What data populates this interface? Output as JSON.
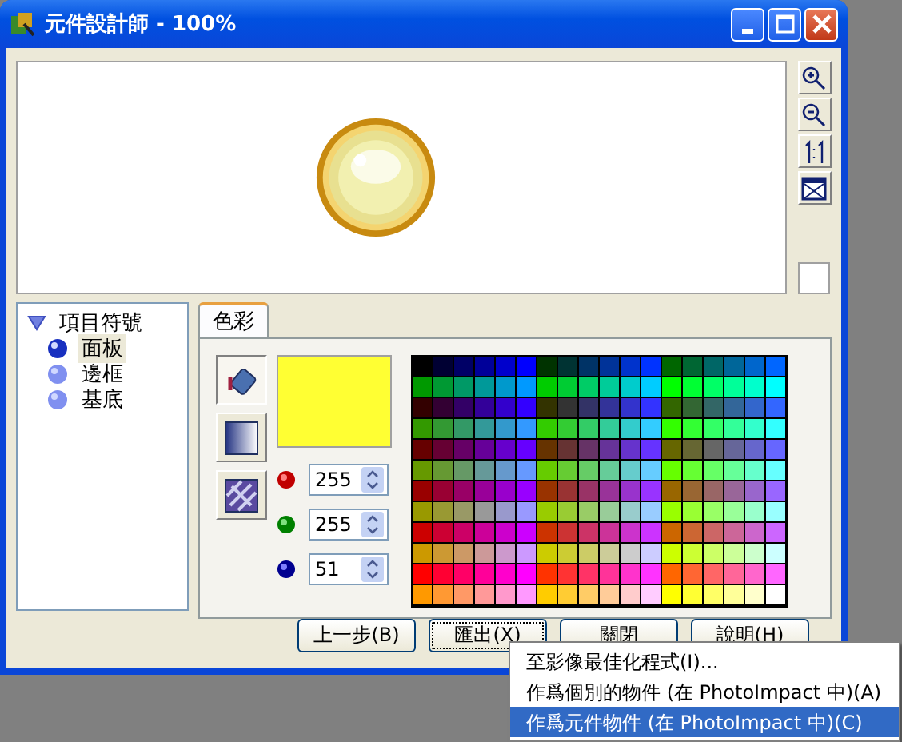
{
  "window": {
    "title": "元件設計師 - 100%"
  },
  "tree": {
    "label": "項目符號",
    "expanded": true,
    "children": [
      {
        "label": "面板",
        "selected": true
      },
      {
        "label": "邊框",
        "selected": false
      },
      {
        "label": "基底",
        "selected": false
      }
    ]
  },
  "tabs": [
    {
      "label": "色彩",
      "selected": true
    }
  ],
  "fill_tools": [
    {
      "kind": "solid",
      "selected": true
    },
    {
      "kind": "gradient",
      "selected": false
    },
    {
      "kind": "texture",
      "selected": false
    }
  ],
  "color_preview": {
    "color": "#ffff33"
  },
  "channels": [
    {
      "kind": "red",
      "value": "255"
    },
    {
      "kind": "green",
      "value": "255"
    },
    {
      "kind": "blue",
      "value": "51"
    }
  ],
  "buttons": [
    {
      "label": "上一步(B)",
      "focused": false
    },
    {
      "label": "匯出(X)",
      "focused": true
    },
    {
      "label": "關閉",
      "focused": false
    },
    {
      "label": "說明(H)",
      "focused": false
    }
  ],
  "menu": [
    {
      "label": "至影像最佳化程式(I)...",
      "selected": false
    },
    {
      "label": "作爲個別的物件 (在 PhotoImpact 中)(A)",
      "selected": false
    },
    {
      "label": "作爲元件物件 (在 PhotoImpact 中)(C)",
      "selected": true
    }
  ]
}
